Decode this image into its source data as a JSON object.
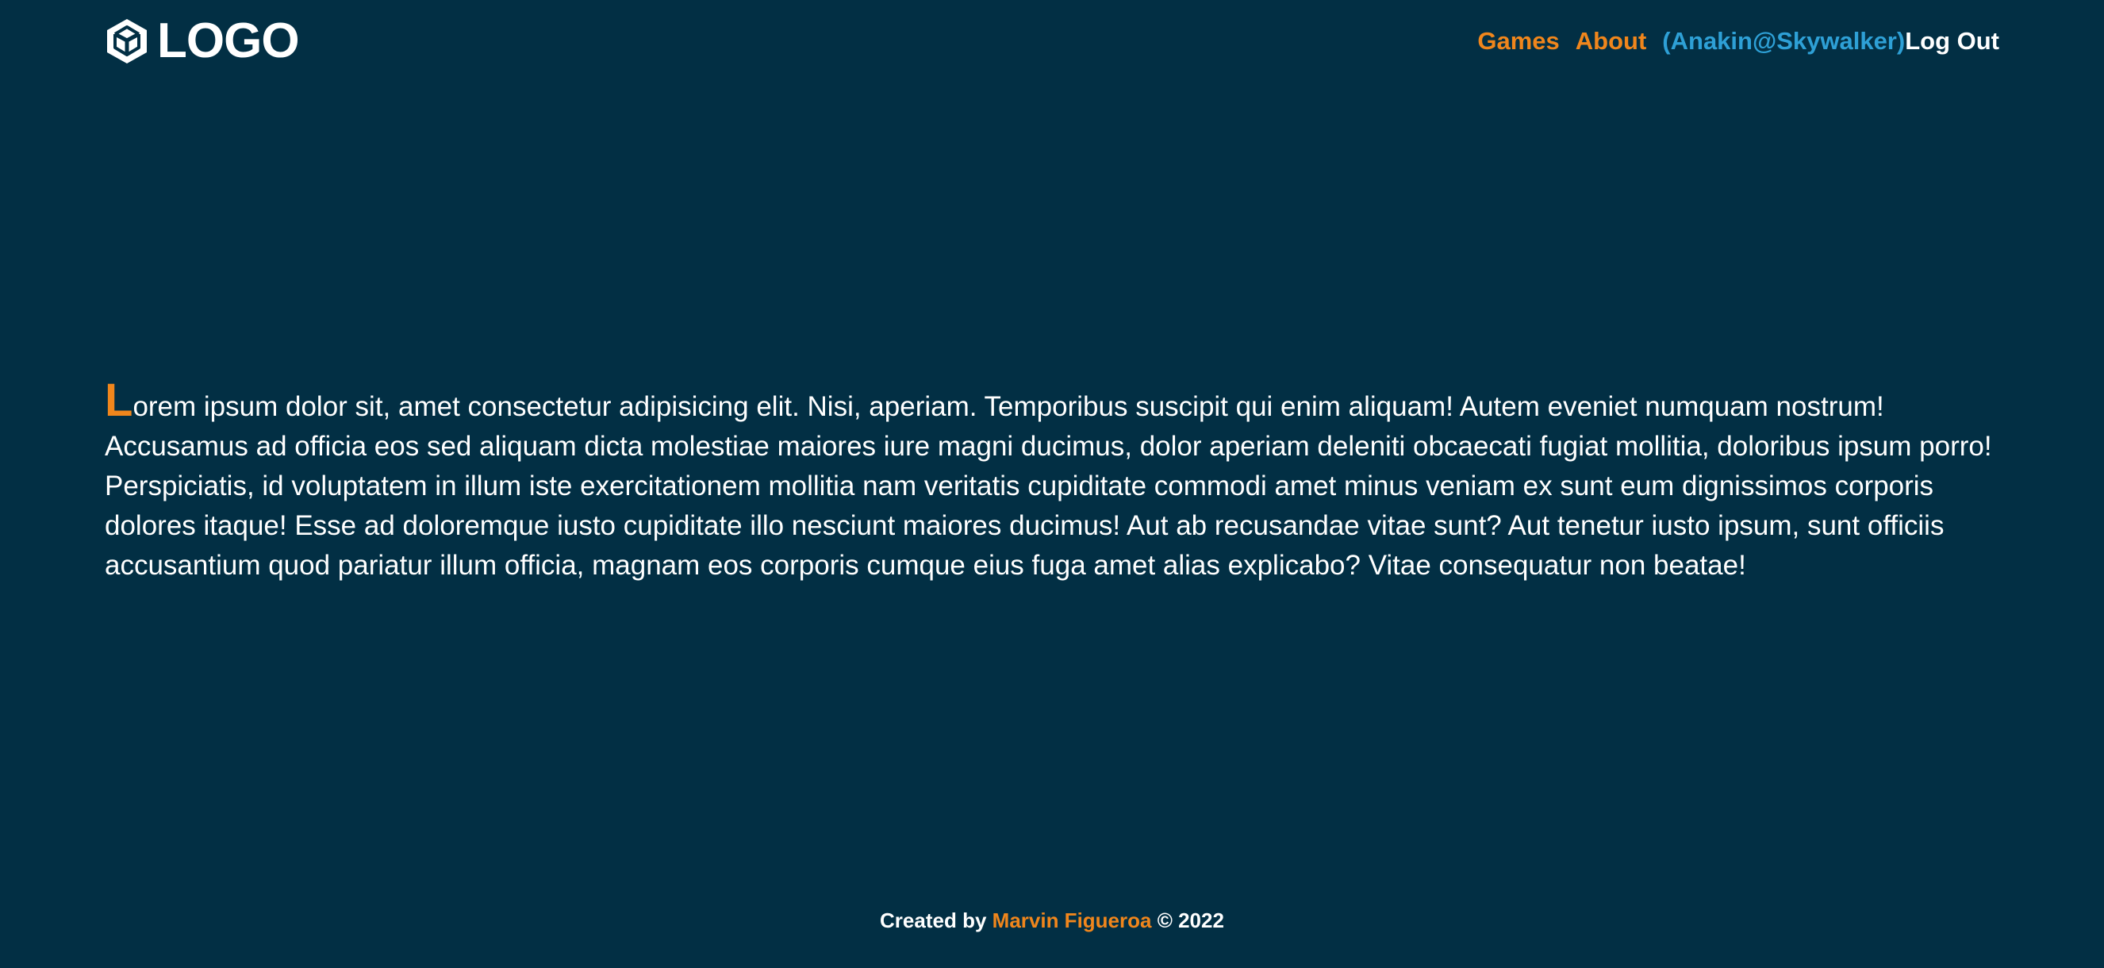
{
  "header": {
    "logo_text": "LOGO",
    "nav": {
      "games": "Games",
      "about": "About",
      "user": "(Anakin@Skywalker)",
      "logout": "Log Out"
    }
  },
  "main": {
    "paragraph_first_letter": "L",
    "paragraph_rest": "orem ipsum dolor sit, amet consectetur adipisicing elit. Nisi, aperiam. Temporibus suscipit qui enim aliquam! Autem eveniet numquam nostrum! Accusamus ad officia eos sed aliquam dicta molestiae maiores iure magni ducimus, dolor aperiam deleniti obcaecati fugiat mollitia, doloribus ipsum porro! Perspiciatis, id voluptatem in illum iste exercitationem mollitia nam veritatis cupiditate commodi amet minus veniam ex sunt eum dignissimos corporis dolores itaque! Esse ad doloremque iusto cupiditate illo nesciunt maiores ducimus! Aut ab recusandae vitae sunt? Aut tenetur iusto ipsum, sunt officiis accusantium quod pariatur illum officia, magnam eos corporis cumque eius fuga amet alias explicabo? Vitae consequatur non beatae!"
  },
  "footer": {
    "prefix": "Created by",
    "author": "Marvin Figueroa",
    "suffix": "© 2022"
  },
  "colors": {
    "background": "#022f44",
    "accent": "#f0861c",
    "user_link": "#2ea0d6",
    "text": "#ffffff"
  },
  "icons": {
    "logo": "cube-logo-icon"
  }
}
